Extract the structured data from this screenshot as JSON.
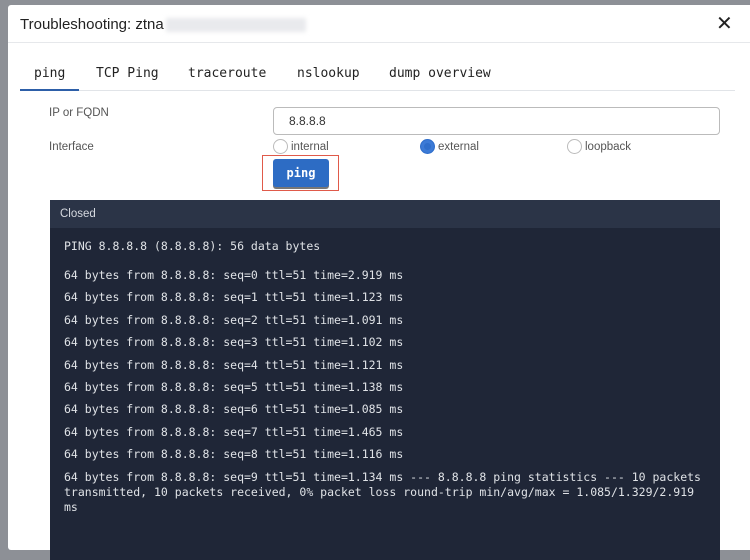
{
  "dialog": {
    "title": "Troubleshooting: ztna",
    "close_icon": "close-icon"
  },
  "tabs": [
    {
      "label": "ping",
      "active": true
    },
    {
      "label": "TCP Ping"
    },
    {
      "label": "traceroute"
    },
    {
      "label": "nslookup"
    },
    {
      "label": "dump overview"
    }
  ],
  "form": {
    "ip_label": "IP or FQDN",
    "ip_value": "8.8.8.8",
    "interface_label": "Interface",
    "interfaces": [
      {
        "label": "internal",
        "selected": false
      },
      {
        "label": "external",
        "selected": true
      },
      {
        "label": "loopback",
        "selected": false
      }
    ],
    "ping_button": "ping"
  },
  "terminal": {
    "status": "Closed",
    "lines": [
      "PING 8.8.8.8 (8.8.8.8): 56 data bytes",
      "64 bytes from 8.8.8.8: seq=0 ttl=51 time=2.919 ms",
      "64 bytes from 8.8.8.8: seq=1 ttl=51 time=1.123 ms",
      "64 bytes from 8.8.8.8: seq=2 ttl=51 time=1.091 ms",
      "64 bytes from 8.8.8.8: seq=3 ttl=51 time=1.102 ms",
      "64 bytes from 8.8.8.8: seq=4 ttl=51 time=1.121 ms",
      "64 bytes from 8.8.8.8: seq=5 ttl=51 time=1.138 ms",
      "64 bytes from 8.8.8.8: seq=6 ttl=51 time=1.085 ms",
      "64 bytes from 8.8.8.8: seq=7 ttl=51 time=1.465 ms",
      "64 bytes from 8.8.8.8: seq=8 ttl=51 time=1.116 ms",
      "64 bytes from 8.8.8.8: seq=9 ttl=51 time=1.134 ms --- 8.8.8.8 ping statistics --- 10 packets transmitted, 10 packets received, 0% packet loss round-trip min/avg/max = 1.085/1.329/2.919 ms"
    ]
  }
}
